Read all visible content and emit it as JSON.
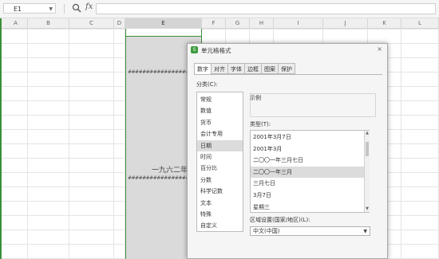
{
  "formula_bar": {
    "name_box": "E1",
    "fx_label": "fx"
  },
  "columns": [
    {
      "label": "A"
    },
    {
      "label": "B"
    },
    {
      "label": "C"
    },
    {
      "label": "D"
    },
    {
      "label": "E"
    },
    {
      "label": "F"
    },
    {
      "label": "G"
    },
    {
      "label": "H"
    },
    {
      "label": "I"
    },
    {
      "label": "J"
    },
    {
      "label": "K"
    },
    {
      "label": "L"
    }
  ],
  "sheet": {
    "hash_top": "######################",
    "cell_text": "一九六二年",
    "hash_bottom": "######################"
  },
  "dialog": {
    "title": "单元格格式",
    "close": "×",
    "tabs": [
      "数字",
      "对齐",
      "字体",
      "边框",
      "图案",
      "保护"
    ],
    "category_label": "分类(C):",
    "categories": [
      "常规",
      "数值",
      "货币",
      "会计专用",
      "日期",
      "时间",
      "百分比",
      "分数",
      "科学记数",
      "文本",
      "特殊",
      "自定义"
    ],
    "selected_category": "日期",
    "sample_label": "示例",
    "type_label": "类型(T):",
    "types": [
      "2001年3月7日",
      "2001年3月",
      "二〇〇一年三月七日",
      "二〇〇一年三月",
      "三月七日",
      "3月7日",
      "星期三"
    ],
    "selected_type": "二〇〇一年三月",
    "region_label": "区域设置(国家/地区)(L):",
    "region_value": "中文(中国)"
  },
  "colors": {
    "accent_green": "#3a8f3a",
    "selection_gray": "#dcdcdc"
  }
}
